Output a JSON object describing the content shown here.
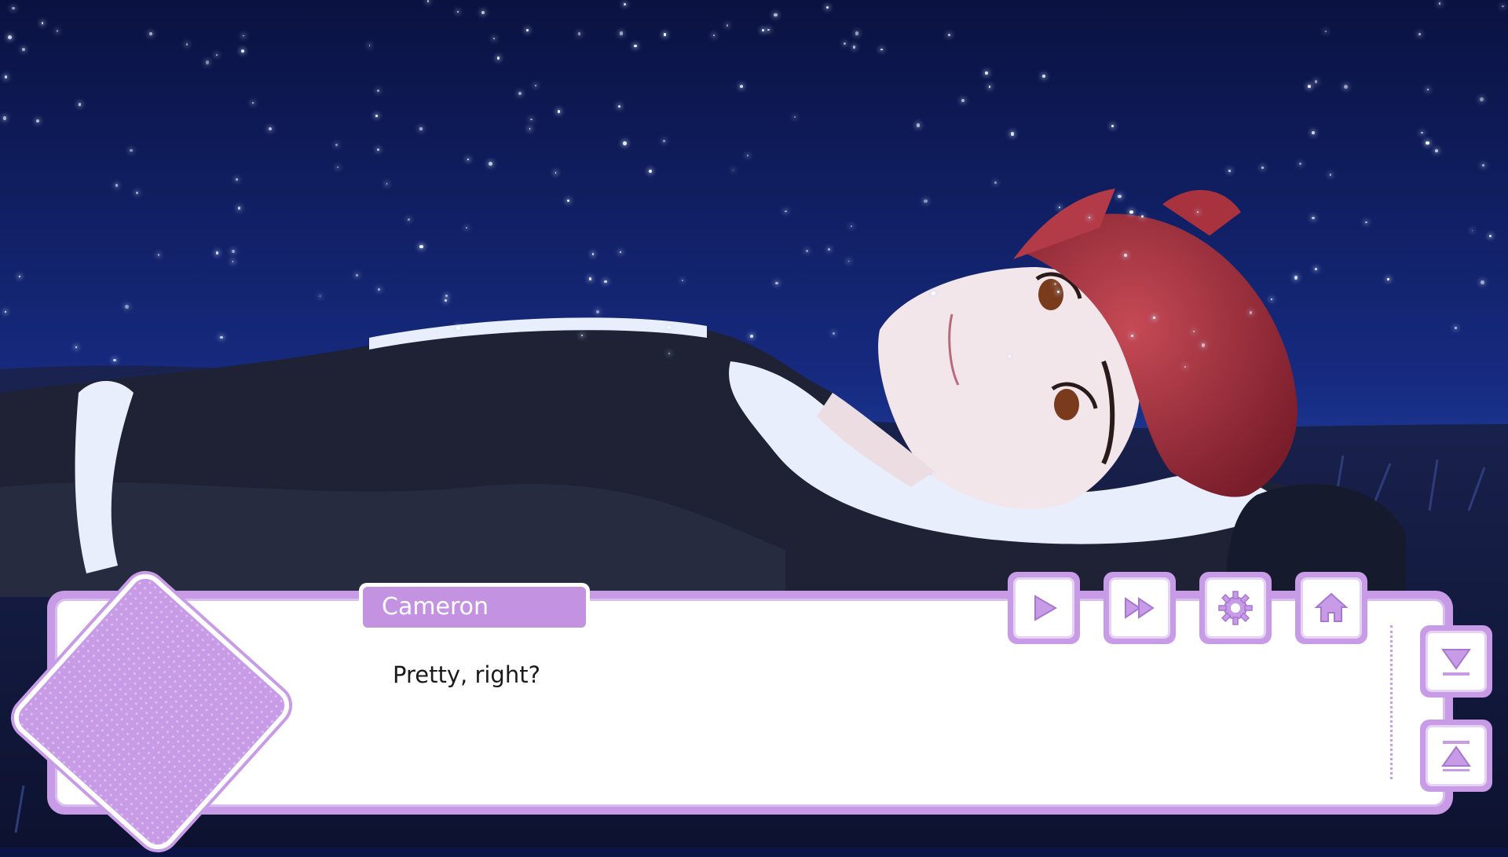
{
  "scene": {
    "background": "night-sky-with-stars",
    "character": "red-haired-young-man-lying-on-grass"
  },
  "dialogue": {
    "speaker": "Cameron",
    "text": "Pretty, right?"
  },
  "toolbar": {
    "play": "play-icon",
    "fast_forward": "fast-forward-icon",
    "settings": "gear-icon",
    "home": "home-icon"
  },
  "side_controls": {
    "down": "scroll-down-icon",
    "up": "scroll-to-top-icon"
  },
  "colors": {
    "sky_top": "#0a1240",
    "sky_bottom": "#1e3a9a",
    "ui_accent": "#c79be6",
    "name_plate": "#c393e2",
    "hair": "#a8323e",
    "jacket": "#1e2234"
  }
}
